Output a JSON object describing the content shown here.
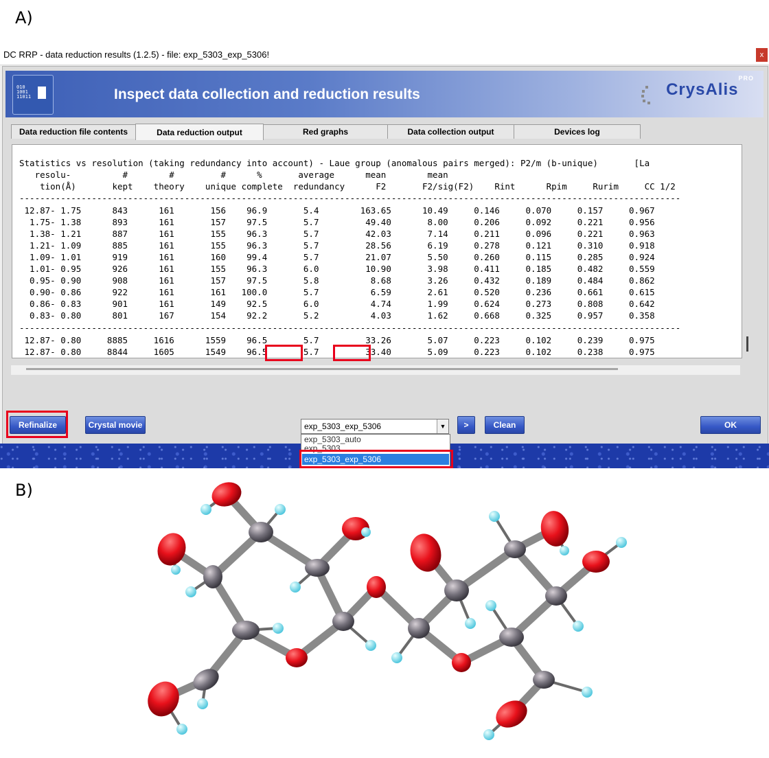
{
  "labels": {
    "a": "A)",
    "b": "B)"
  },
  "window": {
    "title": "DC RRP - data reduction results (1.2.5) - file:  exp_5303_exp_5306!",
    "close": "x"
  },
  "banner": {
    "logo_bits": [
      "010",
      "1001",
      "11011"
    ],
    "title": "Inspect data collection and reduction results",
    "brand": "CrysAlis",
    "brand_sup": "PRO"
  },
  "tabs": [
    "Data reduction file contents",
    "Data reduction output",
    "Red graphs",
    "Data collection output",
    "Devices log"
  ],
  "table": {
    "title": "Statistics vs resolution (taking redundancy into account) - Laue group (anomalous pairs merged): P2/m (b-unique)       [La",
    "header1": "   resolu-          #        #         #      %       average      mean        mean",
    "header2": "    tion(Å)       kept    theory    unique complete  redundancy      F2       F2/sig(F2)    Rint      Rpim     Rurim     CC 1/2",
    "rule": "--------------------------------------------------------------------------------------------------------------------------------",
    "rows": [
      " 12.87- 1.75      843      161       156    96.9       5.4        163.65      10.49     0.146     0.070     0.157     0.967",
      "  1.75- 1.38      893      161       157    97.5       5.7         49.40       8.00     0.206     0.092     0.221     0.956",
      "  1.38- 1.21      887      161       155    96.3       5.7         42.03       7.14     0.211     0.096     0.221     0.963",
      "  1.21- 1.09      885      161       155    96.3       5.7         28.56       6.19     0.278     0.121     0.310     0.918",
      "  1.09- 1.01      919      161       160    99.4       5.7         21.07       5.50     0.260     0.115     0.285     0.924",
      "  1.01- 0.95      926      161       155    96.3       6.0         10.90       3.98     0.411     0.185     0.482     0.559",
      "  0.95- 0.90      908      161       157    97.5       5.8          8.68       3.26     0.432     0.189     0.484     0.862",
      "  0.90- 0.86      922      161       161   100.0       5.7          6.59       2.61     0.520     0.236     0.661     0.615",
      "  0.86- 0.83      901      161       149    92.5       6.0          4.74       1.99     0.624     0.273     0.808     0.642",
      "  0.83- 0.80      801      167       154    92.2       5.2          4.03       1.62     0.668     0.325     0.957     0.358"
    ],
    "totals": [
      " 12.87- 0.80     8885     1616      1559    96.5       5.7         33.26       5.07     0.223     0.102     0.239     0.975",
      " 12.87- 0.80     8844     1605      1549    96.5       5.7         33.40       5.09     0.223     0.102     0.238     0.975"
    ]
  },
  "buttons": {
    "refinalize": "Refinalize",
    "crystal_movie": "Crystal movie",
    "next": ">",
    "clean": "Clean",
    "ok": "OK"
  },
  "combo": {
    "value": "exp_5303_exp_5306",
    "options": [
      "exp_5303_auto",
      "exp_5303",
      "exp_5303_exp_5306"
    ]
  },
  "colors": {
    "highlight_red": "#e8001c",
    "oxygen": "#e8111b",
    "carbon": "#6f6f78",
    "hydrogen": "#7fd6e6",
    "bond": "#8a8a8a"
  }
}
